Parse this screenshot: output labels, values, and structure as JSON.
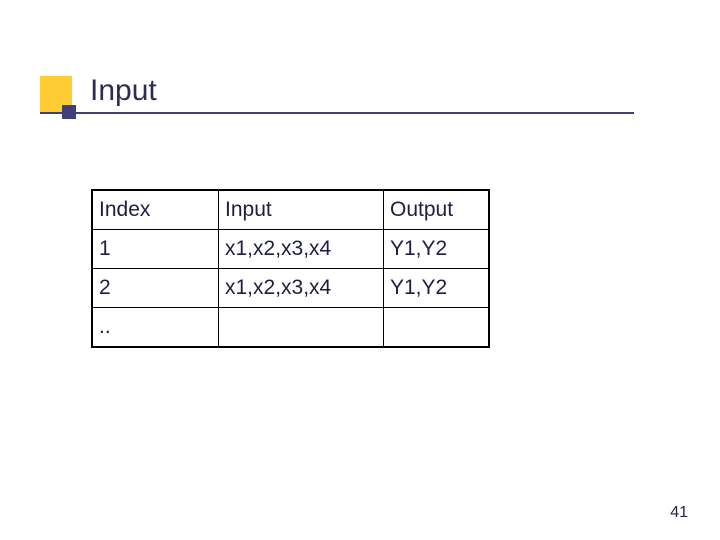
{
  "title": "Input",
  "table": {
    "header": [
      "Index",
      "Input",
      "Output"
    ],
    "rows": [
      {
        "index": "1",
        "input": "x1,x2,x3,x4",
        "output": "Y1,Y2"
      },
      {
        "index": "2",
        "input": "x1,x2,x3,x4",
        "output": "Y1,Y2"
      },
      {
        "index": "..",
        "input": "",
        "output": ""
      }
    ]
  },
  "page_number": "41"
}
